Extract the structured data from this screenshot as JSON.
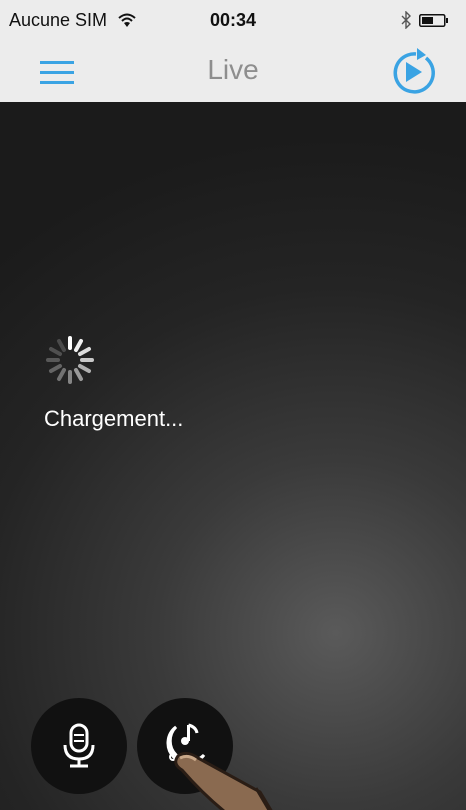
{
  "status_bar": {
    "carrier": "Aucune SIM",
    "time": "00:34",
    "icons": [
      "wifi-icon",
      "bluetooth-icon",
      "battery-icon"
    ]
  },
  "nav": {
    "title": "Live",
    "menu_icon": "hamburger-menu-icon",
    "replay_icon": "replay-play-icon",
    "accent_color": "#3aa3e3"
  },
  "video": {
    "loading_text": "Chargement...",
    "spinner_icon": "loading-spinner-icon"
  },
  "controls": {
    "mic_icon": "microphone-icon",
    "lullaby_icon": "moon-music-icon"
  }
}
